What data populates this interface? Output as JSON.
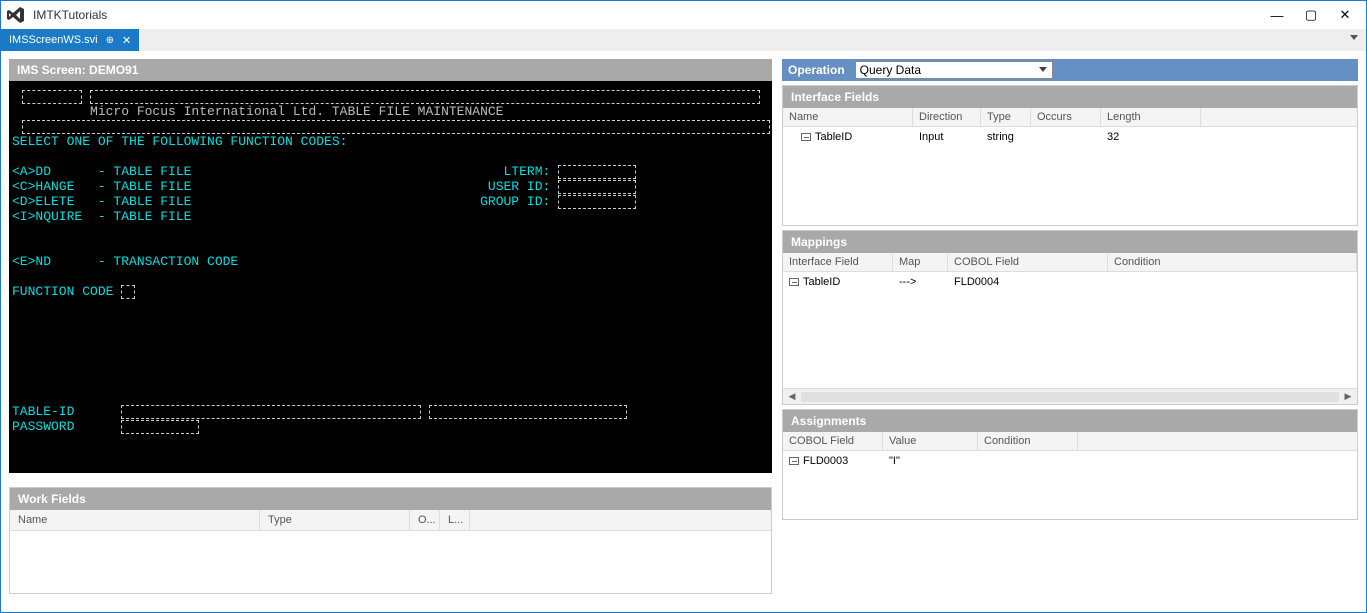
{
  "window": {
    "title": "IMTKTutorials"
  },
  "tab": {
    "label": "IMSScreenWS.svi"
  },
  "imsScreen": {
    "header": "IMS Screen: DEMO91",
    "bannerLine": "Micro Focus International Ltd. TABLE FILE MAINTENANCE",
    "selectLine": "SELECT ONE OF THE FOLLOWING FUNCTION CODES:",
    "fn_add": "<A>DD      - TABLE FILE",
    "fn_change": "<C>HANGE   - TABLE FILE",
    "fn_delete": "<D>ELETE   - TABLE FILE",
    "fn_inquire": "<I>NQUIRE  - TABLE FILE",
    "fn_end": "<E>ND      - TRANSACTION CODE",
    "rt_lterm": "LTERM:",
    "rt_user": "USER ID:",
    "rt_group": "GROUP ID:",
    "lbl_funccode": "FUNCTION CODE",
    "lbl_tableid": "TABLE-ID",
    "lbl_password": "PASSWORD"
  },
  "workFields": {
    "title": "Work Fields",
    "cols": {
      "name": "Name",
      "type": "Type",
      "o": "O...",
      "l": "L..."
    }
  },
  "operation": {
    "label": "Operation",
    "value": "Query Data"
  },
  "interfaceFields": {
    "title": "Interface Fields",
    "cols": {
      "name": "Name",
      "direction": "Direction",
      "type": "Type",
      "occurs": "Occurs",
      "length": "Length"
    },
    "row": {
      "name": "TableID",
      "direction": "Input",
      "type": "string",
      "occurs": "",
      "length": "32"
    }
  },
  "mappings": {
    "title": "Mappings",
    "cols": {
      "ifield": "Interface Field",
      "map": "Map",
      "cobol": "COBOL Field",
      "condition": "Condition"
    },
    "row": {
      "ifield": "TableID",
      "map": "--->",
      "cobol": "FLD0004",
      "condition": ""
    }
  },
  "assignments": {
    "title": "Assignments",
    "cols": {
      "cobol": "COBOL Field",
      "value": "Value",
      "condition": "Condition"
    },
    "row": {
      "cobol": "FLD0003",
      "value": "\"I\"",
      "condition": ""
    }
  }
}
